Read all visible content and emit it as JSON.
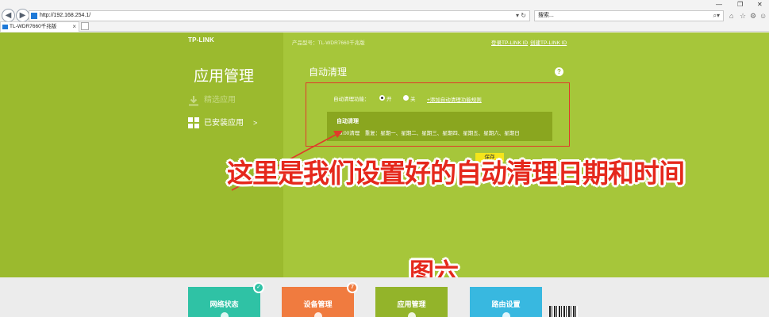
{
  "browser": {
    "url": "http://192.168.254.1/",
    "search_placeholder": "搜索...",
    "tab_title": "TL-WDR7660千兆版"
  },
  "router": {
    "brand": "TP-LINK",
    "model": "产品型号：TL-WDR7660千兆版",
    "links": [
      "登录TP-LINK ID",
      "创建TP-LINK ID"
    ]
  },
  "sidebar": {
    "title": "应用管理",
    "items": [
      {
        "label": "精选应用"
      },
      {
        "label": "已安装应用"
      }
    ]
  },
  "section": {
    "title": "自动清理",
    "help": "?",
    "function_label": "自动清理功能：",
    "radio_on": "开",
    "radio_off": "关",
    "add_rule_link": "+添加自动清理功能规则",
    "rule_title": "自动清理",
    "rule_desc": "03:00清理　重复：星期一、星期二、星期三、星期四、星期五、星期六、星期日",
    "save_label": "保存"
  },
  "annotations": {
    "main": "这里是我们设置好的自动清理日期和时间",
    "figure": "图六"
  },
  "bottom_nav": [
    {
      "label": "网络状态",
      "badge": "✓"
    },
    {
      "label": "设备管理",
      "badge": "7"
    },
    {
      "label": "应用管理"
    },
    {
      "label": "路由设置"
    }
  ],
  "colors": {
    "sidebar_green": "#9bba2e",
    "panel_green": "#a6c63a",
    "highlight_red": "#e03a2a",
    "annotation_red": "#e5281c",
    "save_yellow": "#f4e51b"
  }
}
